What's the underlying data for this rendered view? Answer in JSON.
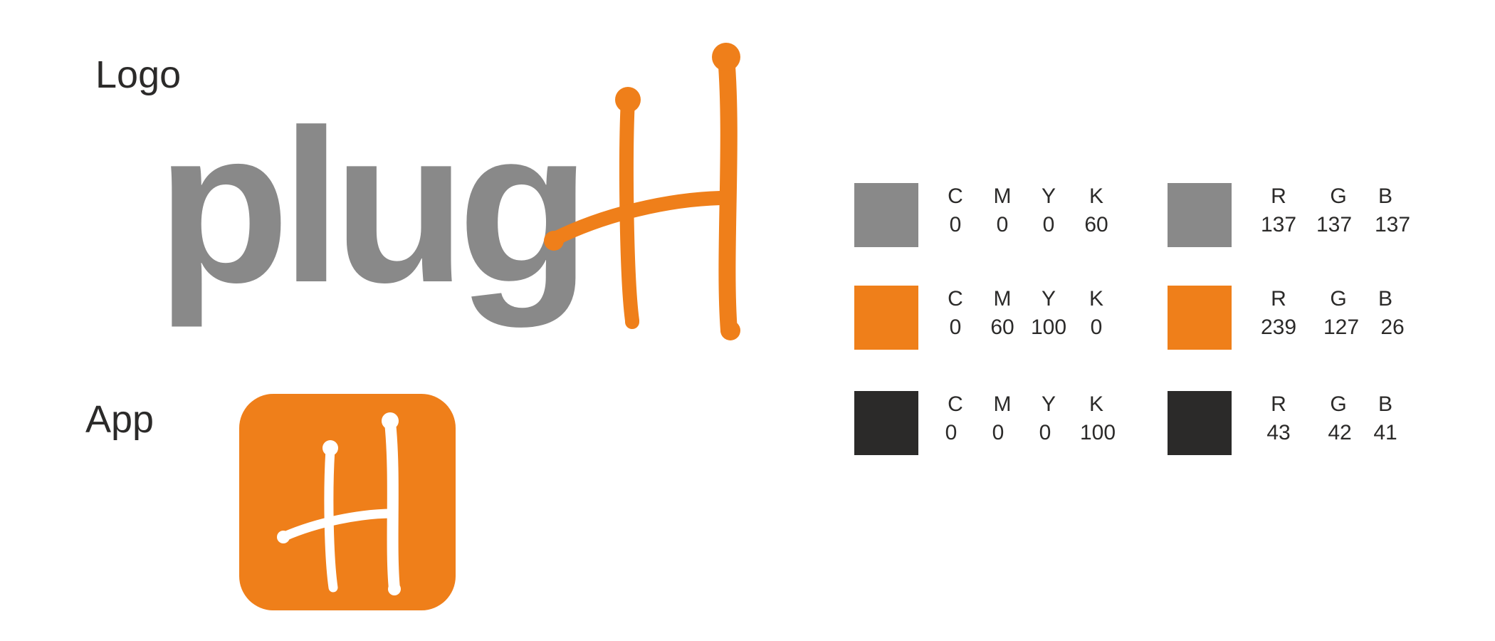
{
  "labels": {
    "logo": "Logo",
    "app": "App"
  },
  "logo": {
    "wordmark": "plug",
    "mark_letter": "H"
  },
  "colors": {
    "gray": "#898989",
    "orange": "#ef7f1a",
    "black": "#2b2a29",
    "white": "#ffffff"
  },
  "swatches": [
    {
      "cmyk": {
        "headers": [
          "C",
          "M",
          "Y",
          "K"
        ],
        "values": [
          "0",
          "0",
          "0",
          "60"
        ]
      },
      "rgb": {
        "headers": [
          "R",
          "G",
          "B"
        ],
        "values": [
          "137",
          "137",
          "137"
        ]
      },
      "color": "#898989"
    },
    {
      "cmyk": {
        "headers": [
          "C",
          "M",
          "Y",
          "K"
        ],
        "values": [
          "0",
          "60",
          "100",
          "0"
        ]
      },
      "rgb": {
        "headers": [
          "R",
          "G",
          "B"
        ],
        "values": [
          "239",
          "127",
          "26"
        ]
      },
      "color": "#ef7f1a"
    },
    {
      "cmyk": {
        "headers": [
          "C",
          "M",
          "Y",
          "K"
        ],
        "values": [
          "0",
          "0",
          "0",
          "100"
        ]
      },
      "rgb": {
        "headers": [
          "R",
          "G",
          "B"
        ],
        "values": [
          "43",
          "42",
          "41"
        ]
      },
      "color": "#2b2a29"
    }
  ]
}
